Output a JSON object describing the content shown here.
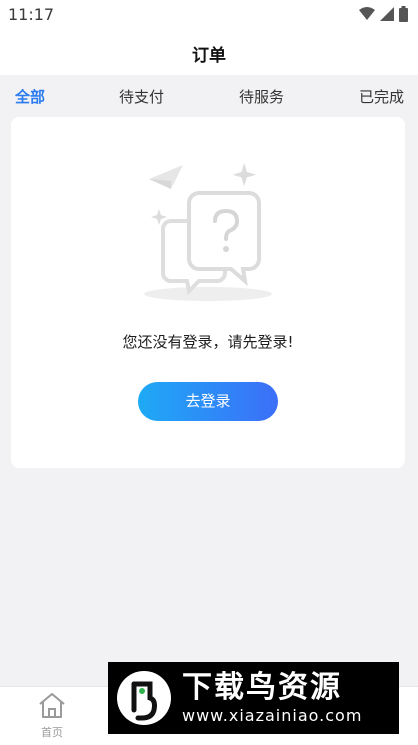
{
  "status_bar": {
    "time": "11:17"
  },
  "header": {
    "title": "订单"
  },
  "tabs": [
    {
      "label": "全部",
      "active": true
    },
    {
      "label": "待支付",
      "active": false
    },
    {
      "label": "待服务",
      "active": false
    },
    {
      "label": "已完成",
      "active": false
    }
  ],
  "empty_state": {
    "message": "您还没有登录，请先登录!",
    "button_label": "去登录"
  },
  "bottom_nav": {
    "items": [
      {
        "label": "首页",
        "icon": "home-icon"
      }
    ]
  },
  "watermark": {
    "title": "下载鸟资源",
    "url": "www.xiazainiao.com"
  },
  "colors": {
    "accent": "#2b7cf0",
    "button_gradient_start": "#1eaaf5",
    "button_gradient_end": "#3c6ef8",
    "background": "#f2f2f4"
  }
}
